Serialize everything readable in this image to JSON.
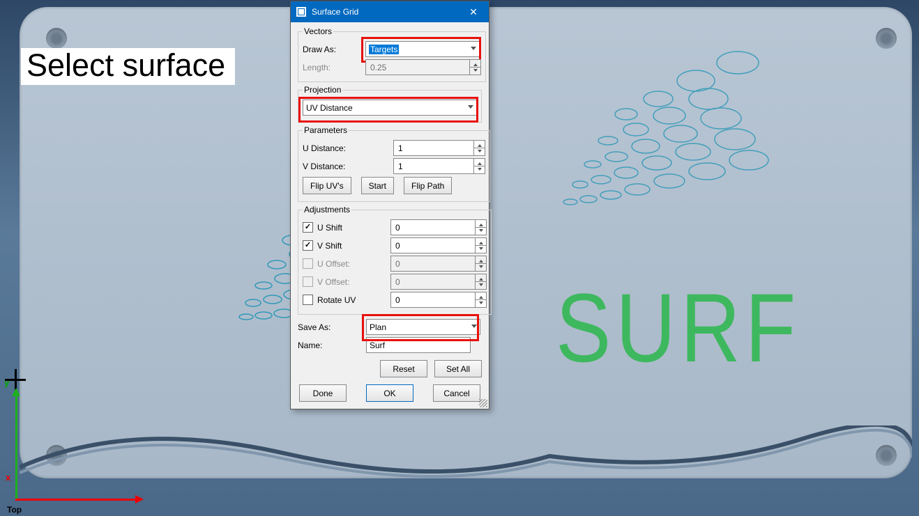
{
  "viewport": {
    "prompt": "Select surface",
    "axis": {
      "x": "x",
      "y": "y",
      "view": "Top"
    },
    "logo": "SURF"
  },
  "dialog": {
    "title": "Surface Grid",
    "close_icon": "✕",
    "vectors": {
      "legend": "Vectors",
      "draw_as_label": "Draw As:",
      "draw_as_value": "Targets",
      "length_label": "Length:",
      "length_value": "0.25"
    },
    "projection": {
      "legend": "Projection",
      "value": "UV Distance"
    },
    "parameters": {
      "legend": "Parameters",
      "u_distance_label": "U Distance:",
      "u_distance_value": "1",
      "v_distance_label": "V Distance:",
      "v_distance_value": "1",
      "flip_uvs": "Flip UV's",
      "start": "Start",
      "flip_path": "Flip Path"
    },
    "adjustments": {
      "legend": "Adjustments",
      "u_shift_label": "U Shift",
      "u_shift_checked": true,
      "u_shift_value": "0",
      "v_shift_label": "V Shift",
      "v_shift_checked": true,
      "v_shift_value": "0",
      "u_offset_label": "U Offset:",
      "u_offset_checked": false,
      "u_offset_value": "0",
      "v_offset_label": "V Offset:",
      "v_offset_checked": false,
      "v_offset_value": "0",
      "rotate_uv_label": "Rotate UV",
      "rotate_uv_checked": false,
      "rotate_uv_value": "0"
    },
    "save": {
      "save_as_label": "Save As:",
      "save_as_value": "Plan",
      "name_label": "Name:",
      "name_value": "Surf"
    },
    "buttons": {
      "reset": "Reset",
      "set_all": "Set All",
      "done": "Done",
      "ok": "OK",
      "cancel": "Cancel"
    }
  }
}
